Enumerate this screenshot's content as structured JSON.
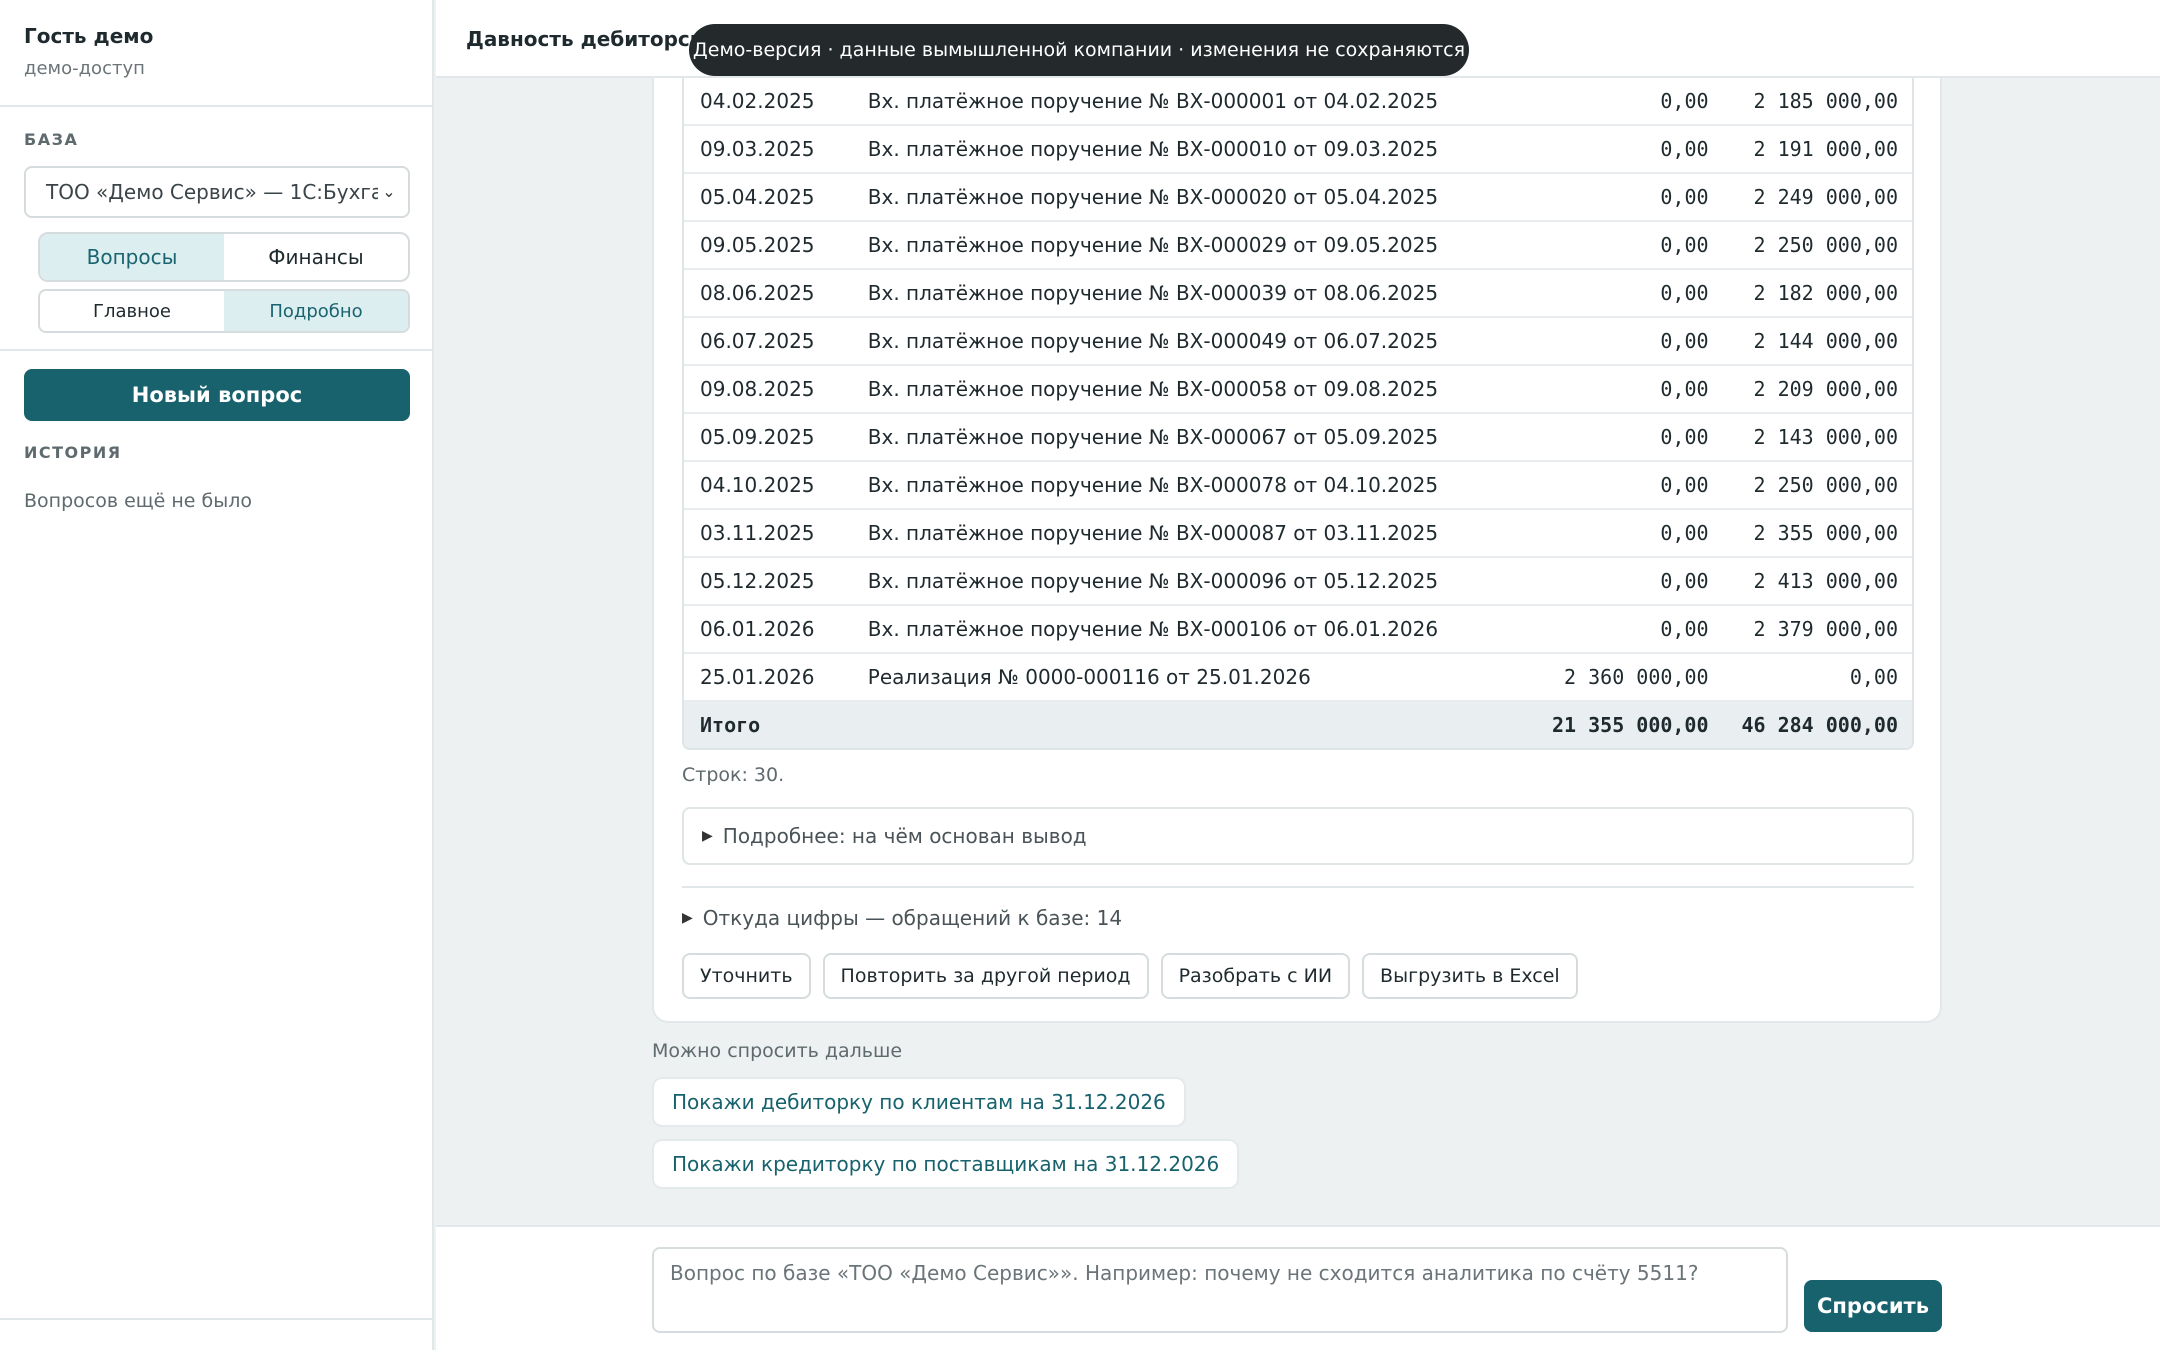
{
  "sidebar": {
    "user_name": "Гость демо",
    "user_role": "демо-доступ",
    "base_label": "БАЗА",
    "db_selected": "ТОО «Демо Сервис» — 1С:Бухга",
    "mode_tabs": [
      {
        "label": "Вопросы",
        "active": true
      },
      {
        "label": "Финансы",
        "active": false
      }
    ],
    "view_tabs": [
      {
        "label": "Главное",
        "active": false
      },
      {
        "label": "Подробно",
        "active": true
      }
    ],
    "new_question": "Новый вопрос",
    "history_label": "ИСТОРИЯ",
    "history_empty": "Вопросов ещё не было"
  },
  "header": {
    "title": "Давность дебиторской задолженности"
  },
  "toast": "Демо-версия · данные вымышленной компании · изменения не сохраняются",
  "table": {
    "rows": [
      {
        "date": "04.02.2025",
        "doc": "Вх. платёжное поручение № ВХ-000001 от 04.02.2025",
        "debit": "0,00",
        "credit": "2 185 000,00"
      },
      {
        "date": "09.03.2025",
        "doc": "Вх. платёжное поручение № ВХ-000010 от 09.03.2025",
        "debit": "0,00",
        "credit": "2 191 000,00"
      },
      {
        "date": "05.04.2025",
        "doc": "Вх. платёжное поручение № ВХ-000020 от 05.04.2025",
        "debit": "0,00",
        "credit": "2 249 000,00"
      },
      {
        "date": "09.05.2025",
        "doc": "Вх. платёжное поручение № ВХ-000029 от 09.05.2025",
        "debit": "0,00",
        "credit": "2 250 000,00"
      },
      {
        "date": "08.06.2025",
        "doc": "Вх. платёжное поручение № ВХ-000039 от 08.06.2025",
        "debit": "0,00",
        "credit": "2 182 000,00"
      },
      {
        "date": "06.07.2025",
        "doc": "Вх. платёжное поручение № ВХ-000049 от 06.07.2025",
        "debit": "0,00",
        "credit": "2 144 000,00"
      },
      {
        "date": "09.08.2025",
        "doc": "Вх. платёжное поручение № ВХ-000058 от 09.08.2025",
        "debit": "0,00",
        "credit": "2 209 000,00"
      },
      {
        "date": "05.09.2025",
        "doc": "Вх. платёжное поручение № ВХ-000067 от 05.09.2025",
        "debit": "0,00",
        "credit": "2 143 000,00"
      },
      {
        "date": "04.10.2025",
        "doc": "Вх. платёжное поручение № ВХ-000078 от 04.10.2025",
        "debit": "0,00",
        "credit": "2 250 000,00"
      },
      {
        "date": "03.11.2025",
        "doc": "Вх. платёжное поручение № ВХ-000087 от 03.11.2025",
        "debit": "0,00",
        "credit": "2 355 000,00"
      },
      {
        "date": "05.12.2025",
        "doc": "Вх. платёжное поручение № ВХ-000096 от 05.12.2025",
        "debit": "0,00",
        "credit": "2 413 000,00"
      },
      {
        "date": "06.01.2026",
        "doc": "Вх. платёжное поручение № ВХ-000106 от 06.01.2026",
        "debit": "0,00",
        "credit": "2 379 000,00"
      },
      {
        "date": "25.01.2026",
        "doc": "Реализация № 0000-000116 от 25.01.2026",
        "debit": "2 360 000,00",
        "credit": "0,00"
      }
    ],
    "total": {
      "label": "Итого",
      "debit": "21 355 000,00",
      "credit": "46 284 000,00"
    }
  },
  "row_count": "Строк: 30.",
  "details_label": "Подробнее: на чём основан вывод",
  "sources_label": "Откуда цифры — обращений к базе: 14",
  "actions": [
    "Уточнить",
    "Повторить за другой период",
    "Разобрать с ИИ",
    "Выгрузить в Excel"
  ],
  "followup": {
    "label": "Можно спросить дальше",
    "suggestions": [
      "Покажи дебиторку по клиентам на 31.12.2026",
      "Покажи кредиторку по поставщикам на 31.12.2026"
    ]
  },
  "composer": {
    "placeholder": "Вопрос по базе «ТОО «Демо Сервис»». Например: почему не сходится аналитика по счёту 5511?",
    "ask": "Спросить"
  }
}
